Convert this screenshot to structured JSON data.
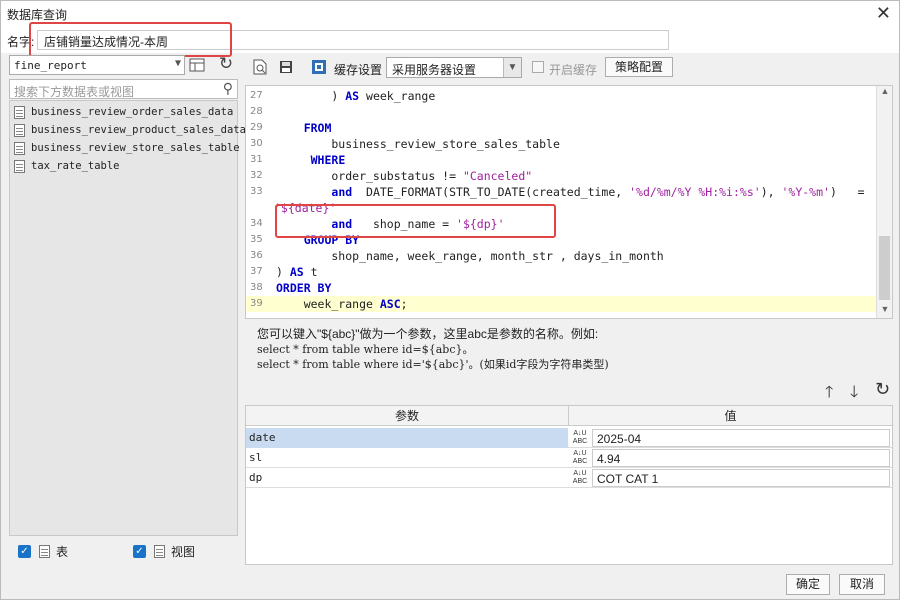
{
  "window": {
    "title": "数据库查询",
    "close_glyph": "✕"
  },
  "name_field": {
    "label": "名字:",
    "value": "店铺销量达成情况-本周"
  },
  "left": {
    "datasource": "fine_report",
    "search_placeholder": "搜索下方数据表或视图",
    "tables": [
      "business_review_order_sales_data",
      "business_review_product_sales_data",
      "business_review_store_sales_table",
      "tax_rate_table"
    ],
    "show_tables_label": "表",
    "show_views_label": "视图"
  },
  "toolbar": {
    "cache_label": "缓存设置",
    "cache_value": "采用服务器设置",
    "enable_cache_label": "开启缓存",
    "strategy_button": "策略配置"
  },
  "sql": [
    {
      "n": "27",
      "parts": [
        [
          "",
          "        ) "
        ],
        [
          "kw",
          "AS"
        ],
        [
          "",
          " week_range"
        ]
      ]
    },
    {
      "n": "28",
      "parts": [
        [
          "",
          ""
        ]
      ]
    },
    {
      "n": "29",
      "parts": [
        [
          "",
          "    "
        ],
        [
          "kw",
          "FROM"
        ]
      ]
    },
    {
      "n": "30",
      "parts": [
        [
          "",
          "        business_review_store_sales_table"
        ]
      ]
    },
    {
      "n": "31",
      "parts": [
        [
          "",
          "     "
        ],
        [
          "kw",
          "WHERE"
        ]
      ]
    },
    {
      "n": "32",
      "parts": [
        [
          "",
          "        order_substatus != "
        ],
        [
          "str",
          "\"Canceled\""
        ]
      ]
    },
    {
      "n": "33",
      "parts": [
        [
          "",
          "        "
        ],
        [
          "kw",
          "and"
        ],
        [
          "",
          "  DATE_FORMAT(STR_TO_DATE(created_time, "
        ],
        [
          "str",
          "'%d/%m/%Y %H:%i:%s'"
        ],
        [
          "",
          "), "
        ],
        [
          "str",
          "'%Y-%m'"
        ],
        [
          "",
          ")   ="
        ]
      ]
    },
    {
      "n": "",
      "parts": [
        [
          "str",
          "'${date}'"
        ]
      ]
    },
    {
      "n": "34",
      "parts": [
        [
          "",
          "        "
        ],
        [
          "kw",
          "and"
        ],
        [
          "",
          "   shop_name = "
        ],
        [
          "str",
          "'${dp}'"
        ]
      ]
    },
    {
      "n": "35",
      "parts": [
        [
          "",
          "    "
        ],
        [
          "kw",
          "GROUP BY"
        ]
      ]
    },
    {
      "n": "36",
      "parts": [
        [
          "",
          "        shop_name, week_range, month_str , days_in_month"
        ]
      ]
    },
    {
      "n": "37",
      "parts": [
        [
          "",
          ") "
        ],
        [
          "kw",
          "AS"
        ],
        [
          "",
          " t"
        ]
      ]
    },
    {
      "n": "38",
      "parts": [
        [
          "kw",
          "ORDER BY"
        ]
      ]
    },
    {
      "n": "39",
      "parts": [
        [
          "",
          "    week_range "
        ],
        [
          "kw",
          "ASC"
        ],
        [
          "",
          ";"
        ]
      ],
      "highlight": true
    }
  ],
  "hint": {
    "line1": "您可以键入\"${abc}\"做为一个参数，这里abc是参数的名称。例如:",
    "line2": "select * from table where id=${abc}。",
    "line3": "select * from table where id='${abc}'。(如果id字段为字符串类型)"
  },
  "params": {
    "header_name": "参数",
    "header_value": "值",
    "type_glyph_top": "A↓U",
    "type_glyph_bottom": "ABC",
    "rows": [
      {
        "name": "date",
        "value": "2025-04"
      },
      {
        "name": "sl",
        "value": "4.94"
      },
      {
        "name": "dp",
        "value": "COT CAT 1"
      }
    ]
  },
  "footer": {
    "ok": "确定",
    "cancel": "取消"
  },
  "colors": {
    "highlight_box": "#e04545",
    "checkbox": "#1a73c9",
    "keyword": "#0000c8",
    "string": "#a020a0"
  }
}
